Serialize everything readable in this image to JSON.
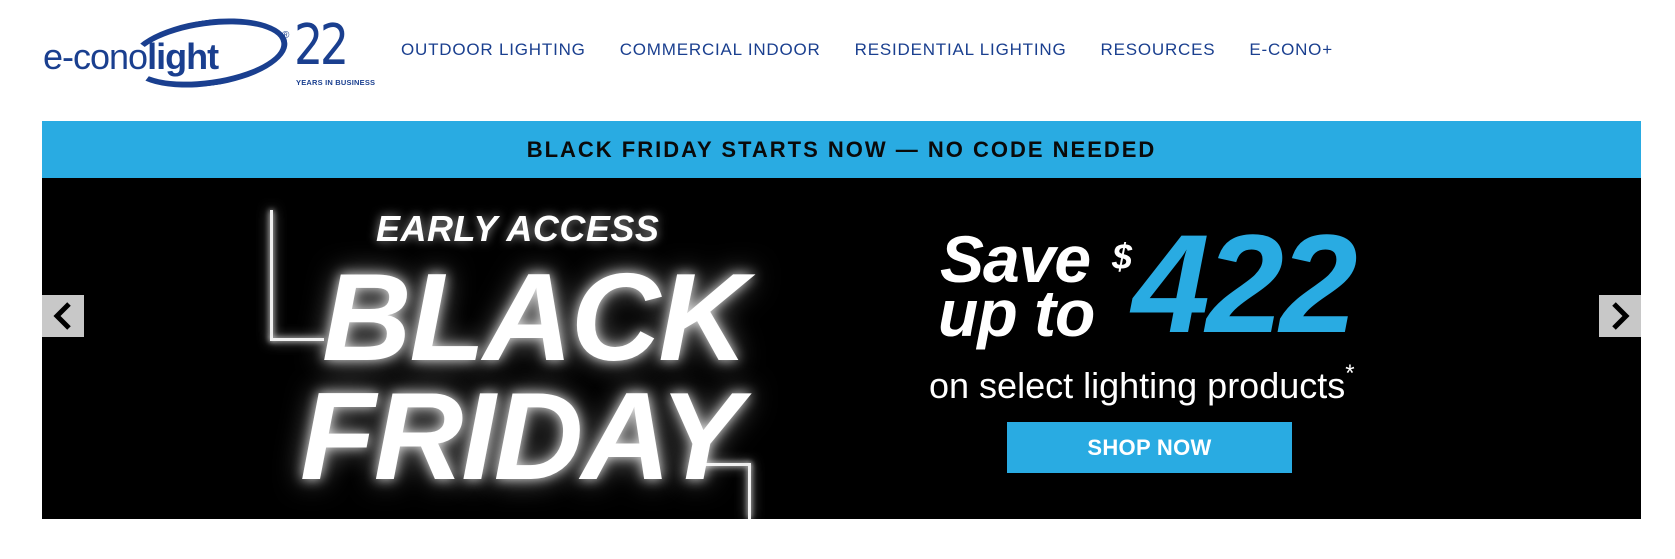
{
  "header": {
    "logo": {
      "text_regular": "e-cono",
      "text_bold": "light",
      "registered": "®",
      "anniversary_number": "22",
      "anniversary_caption": "YEARS IN BUSINESS"
    },
    "nav": {
      "items": [
        {
          "label": "OUTDOOR LIGHTING"
        },
        {
          "label": "COMMERCIAL INDOOR"
        },
        {
          "label": "RESIDENTIAL LIGHTING"
        },
        {
          "label": "RESOURCES"
        },
        {
          "label": "E-CONO+"
        }
      ]
    }
  },
  "promo_bar": {
    "text": "BLACK FRIDAY STARTS NOW — NO CODE NEEDED"
  },
  "banner": {
    "eyebrow": "EARLY ACCESS",
    "headline_line1": "BLACK",
    "headline_line2": "FRIDAY",
    "save_line1": "Save",
    "save_line2": "up to",
    "currency_symbol": "$",
    "amount": "422",
    "subtext": "on select lighting products",
    "subtext_mark": "*",
    "cta_label": "SHOP NOW",
    "prev_icon": "chevron-left-icon",
    "next_icon": "chevron-right-icon"
  },
  "colors": {
    "brand_blue": "#1a3f8f",
    "accent_blue": "#29abe2",
    "banner_bg": "#000000",
    "arrow_bg": "#c8c8c8"
  }
}
